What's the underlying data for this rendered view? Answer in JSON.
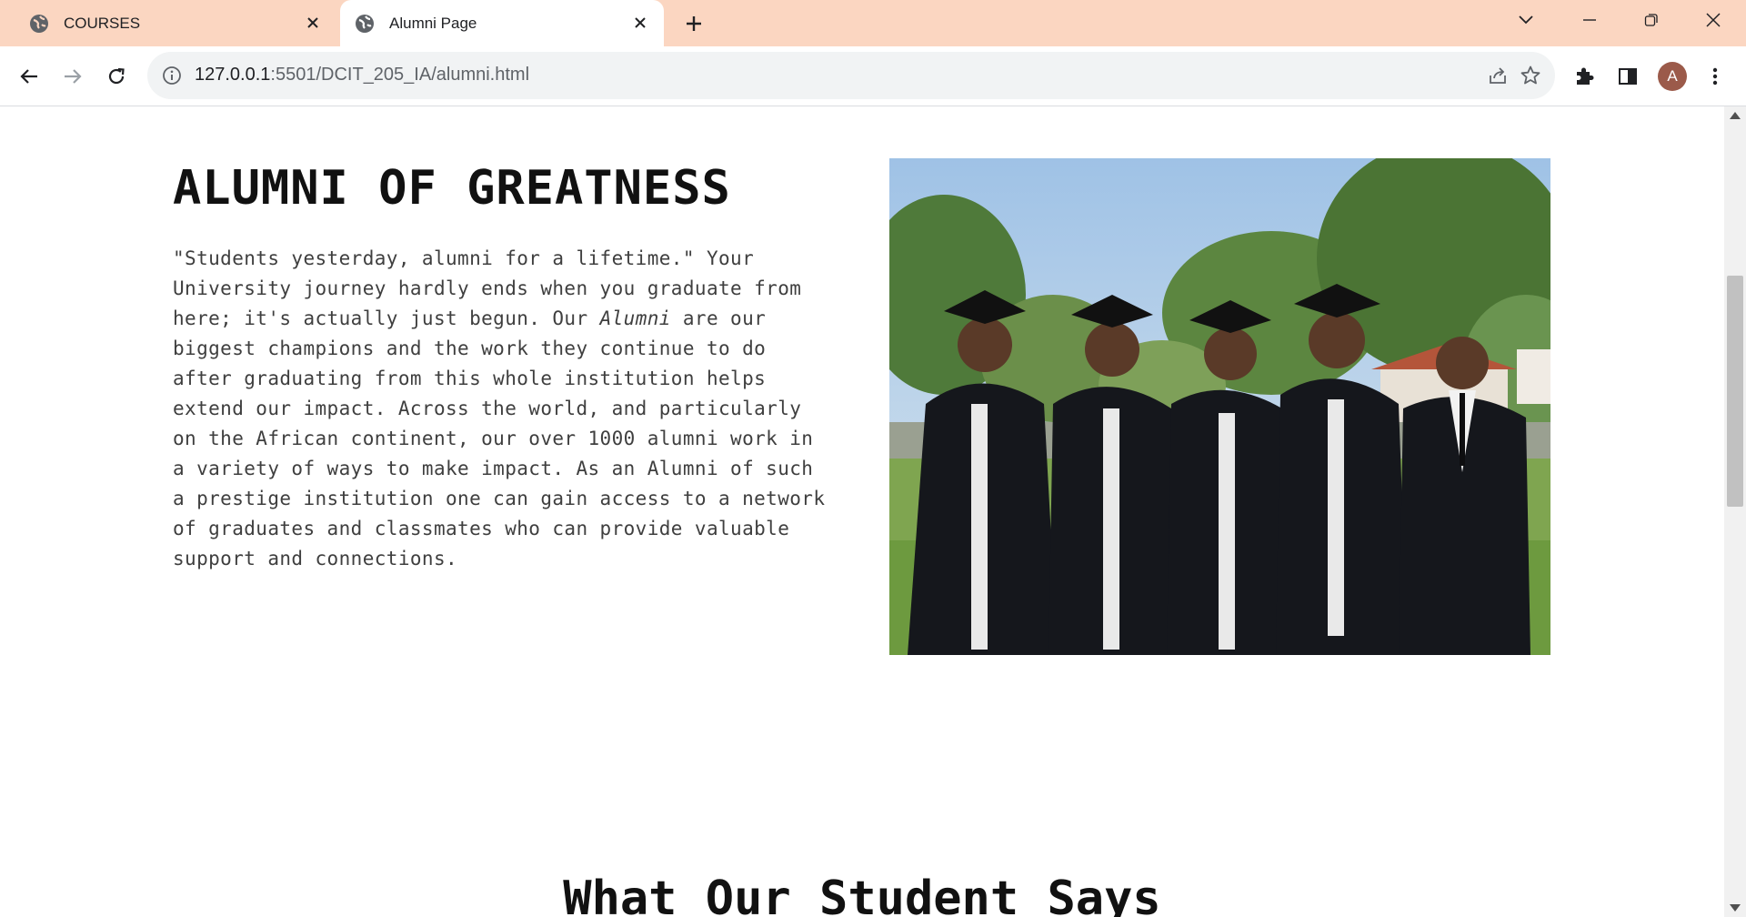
{
  "browser": {
    "tabs": [
      {
        "title": "COURSES",
        "active": false,
        "icon": "globe-icon"
      },
      {
        "title": "Alumni Page",
        "active": true,
        "icon": "globe-icon"
      }
    ],
    "url_host": "127.0.0.1",
    "url_rest": ":5501/DCIT_205_IA/alumni.html",
    "profile_initial": "A",
    "colors": {
      "tabstrip": "#fbd6c1",
      "avatar": "#9b5a4a"
    }
  },
  "page": {
    "hero": {
      "title": "ALUMNI OF GREATNESS",
      "paragraph_before_em": "\"Students yesterday, alumni for a lifetime.\" Your University journey hardly ends when you graduate from here; it's actually just begun. Our ",
      "paragraph_em": "Alumni",
      "paragraph_after_em": " are our biggest champions and the work they continue to do after graduating from this whole institution helps extend our impact. Across the world, and particularly on the African continent, our over 1000 alumni work in a variety of ways to make impact. As an Alumni of such a prestige institution one can gain access to a network of graduates and classmates who can provide valuable support and connections."
    },
    "testimonials_title": "What Our Student Says"
  }
}
